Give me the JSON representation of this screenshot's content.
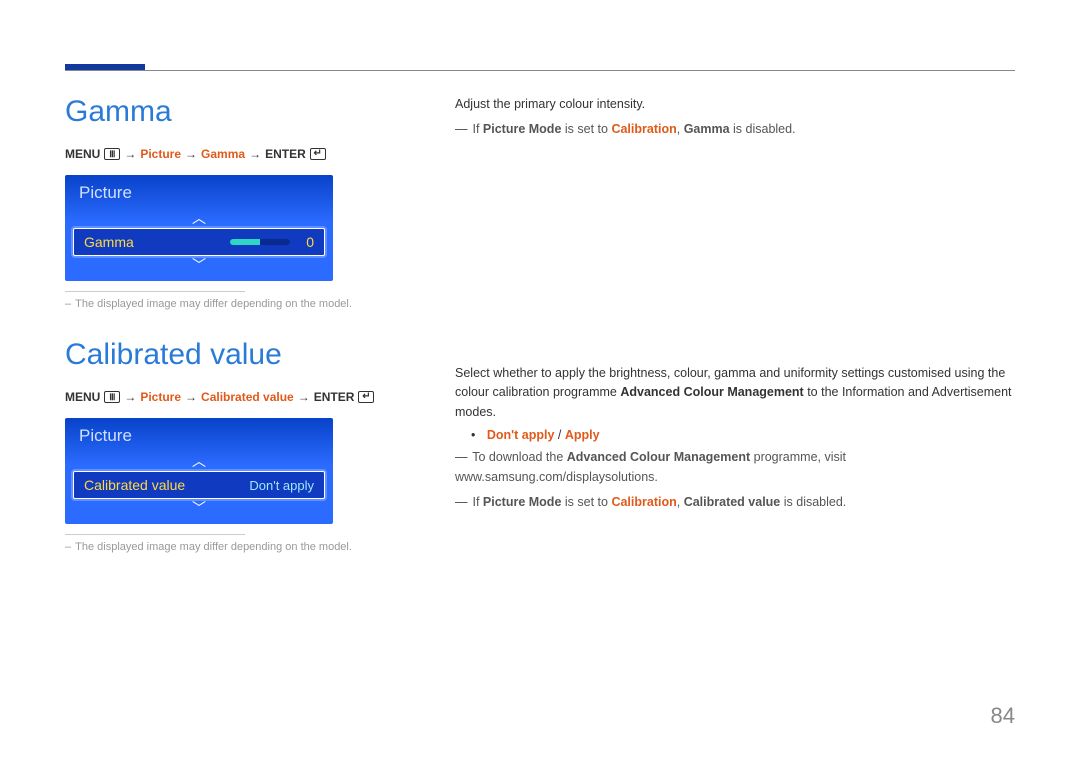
{
  "page_number": "84",
  "gamma": {
    "title": "Gamma",
    "menu_path": {
      "menu": "MENU",
      "picture": "Picture",
      "item": "Gamma",
      "enter": "ENTER"
    },
    "osd": {
      "header": "Picture",
      "row_label": "Gamma",
      "row_value": "0"
    },
    "note": "The displayed image may differ depending on the model.",
    "desc": "Adjust the primary colour intensity.",
    "disable_prefix": "If ",
    "disable_pm": "Picture Mode",
    "disable_mid": " is set to ",
    "disable_cal": "Calibration",
    "disable_comma": ", ",
    "disable_item": "Gamma",
    "disable_suffix": " is disabled."
  },
  "calibrated": {
    "title": "Calibrated value",
    "menu_path": {
      "menu": "MENU",
      "picture": "Picture",
      "item": "Calibrated value",
      "enter": "ENTER"
    },
    "osd": {
      "header": "Picture",
      "row_label": "Calibrated value",
      "row_value": "Don't apply"
    },
    "note": "The displayed image may differ depending on the model.",
    "desc": "Select whether to apply the brightness, colour, gamma and uniformity settings customised using the colour calibration programme Advanced Colour Management to the Information and Advertisement modes.",
    "desc_bold": "Advanced Colour Management",
    "options": {
      "opt1": "Don't apply",
      "sep": " / ",
      "opt2": "Apply"
    },
    "dl_prefix": "To download the ",
    "dl_bold": "Advanced Colour Management",
    "dl_suffix": " programme, visit www.samsung.com/displaysolutions.",
    "disable_prefix": "If ",
    "disable_pm": "Picture Mode",
    "disable_mid": " is set to ",
    "disable_cal": "Calibration",
    "disable_comma": ", ",
    "disable_item": "Calibrated value",
    "disable_suffix": " is disabled."
  }
}
